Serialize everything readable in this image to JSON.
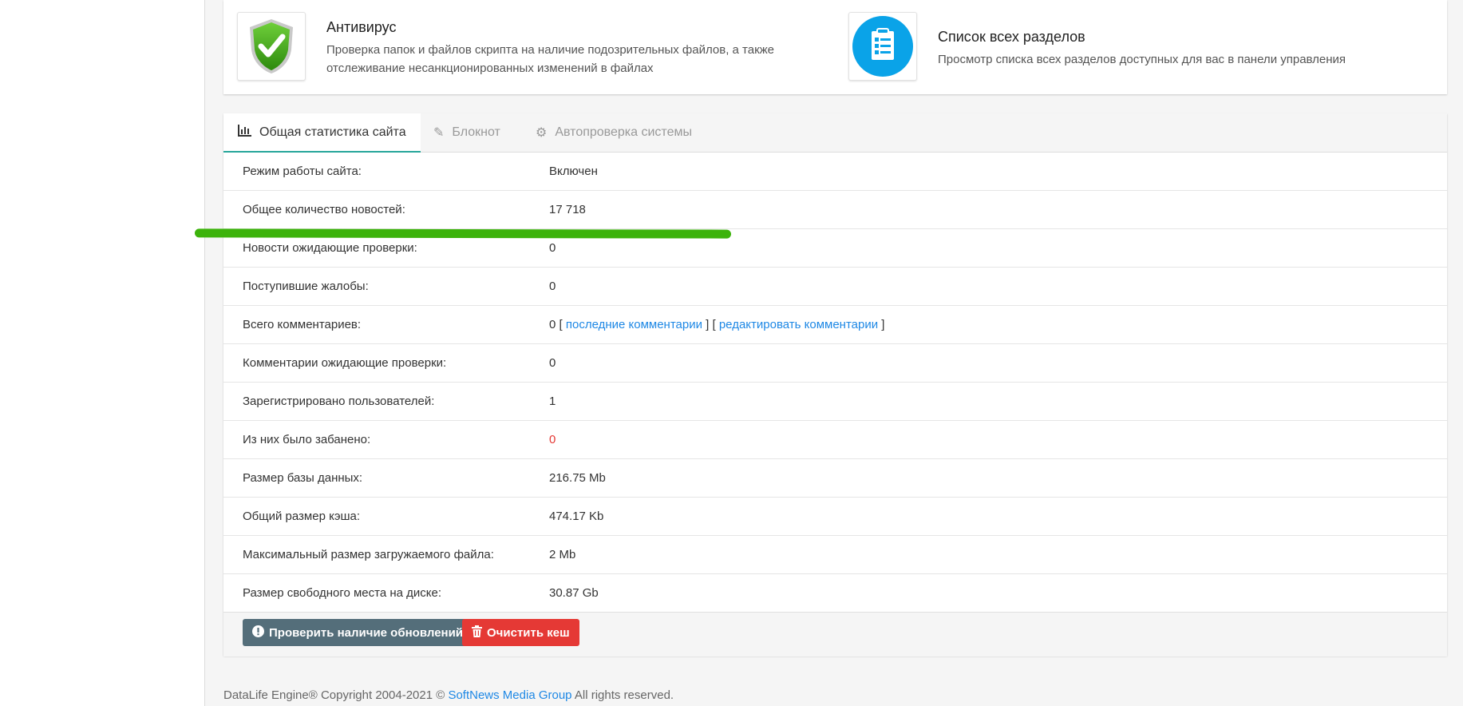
{
  "quick": {
    "antivirus": {
      "title": "Антивирус",
      "desc_line1": "Проверка папок и файлов скрипта на наличие подозрительных файлов, а также",
      "desc_line2": "отслеживание несанкционированных изменений в файлах",
      "icon": "shield-check-icon"
    },
    "sections": {
      "title": "Список всех разделов",
      "desc": "Просмотр списка всех разделов доступных для вас в панели управления",
      "icon": "clipboard-list-icon"
    }
  },
  "tabs": [
    {
      "label": "Общая статистика сайта",
      "icon": "bar-chart-icon",
      "active": true
    },
    {
      "label": "Блокнот",
      "icon": "edit-icon",
      "active": false
    },
    {
      "label": "Автопроверка системы",
      "icon": "gear-icon",
      "active": false
    }
  ],
  "stats": [
    {
      "label": "Режим работы сайта:",
      "value": "Включен"
    },
    {
      "label": "Общее количество новостей:",
      "value": "17 718"
    },
    {
      "label": "Новости ожидающие проверки:",
      "value": "0"
    },
    {
      "label": "Поступившие жалобы:",
      "value": "0"
    },
    {
      "label": "Всего комментариев:",
      "value": "0",
      "bracket_open": "[",
      "link1": "последние комментарии",
      "bracket_mid": "] [",
      "link2": "редактировать комментарии",
      "bracket_close": "]"
    },
    {
      "label": "Комментарии ожидающие проверки:",
      "value": "0"
    },
    {
      "label": "Зарегистрировано пользователей:",
      "value": "1"
    },
    {
      "label": "Из них было забанено:",
      "value": "0"
    },
    {
      "label": "Размер базы данных:",
      "value": "216.75 Mb"
    },
    {
      "label": "Общий размер кэша:",
      "value": "474.17 Kb"
    },
    {
      "label": "Максимальный размер загружаемого файла:",
      "value": "2 Mb"
    },
    {
      "label": "Размер свободного места на диске:",
      "value": "30.87 Gb"
    }
  ],
  "actions": {
    "check_updates": "Проверить наличие обновлений",
    "clear_cache": "Очистить кеш"
  },
  "footer": {
    "prefix": "DataLife Engine® Copyright 2004-2021 ©",
    "link": "SoftNews Media Group",
    "suffix": "All rights reserved."
  },
  "colors": {
    "accent": "#1e88e5",
    "danger": "#e53935",
    "dark_button": "#546e7a",
    "highlight_mark": "#3cb30b"
  }
}
